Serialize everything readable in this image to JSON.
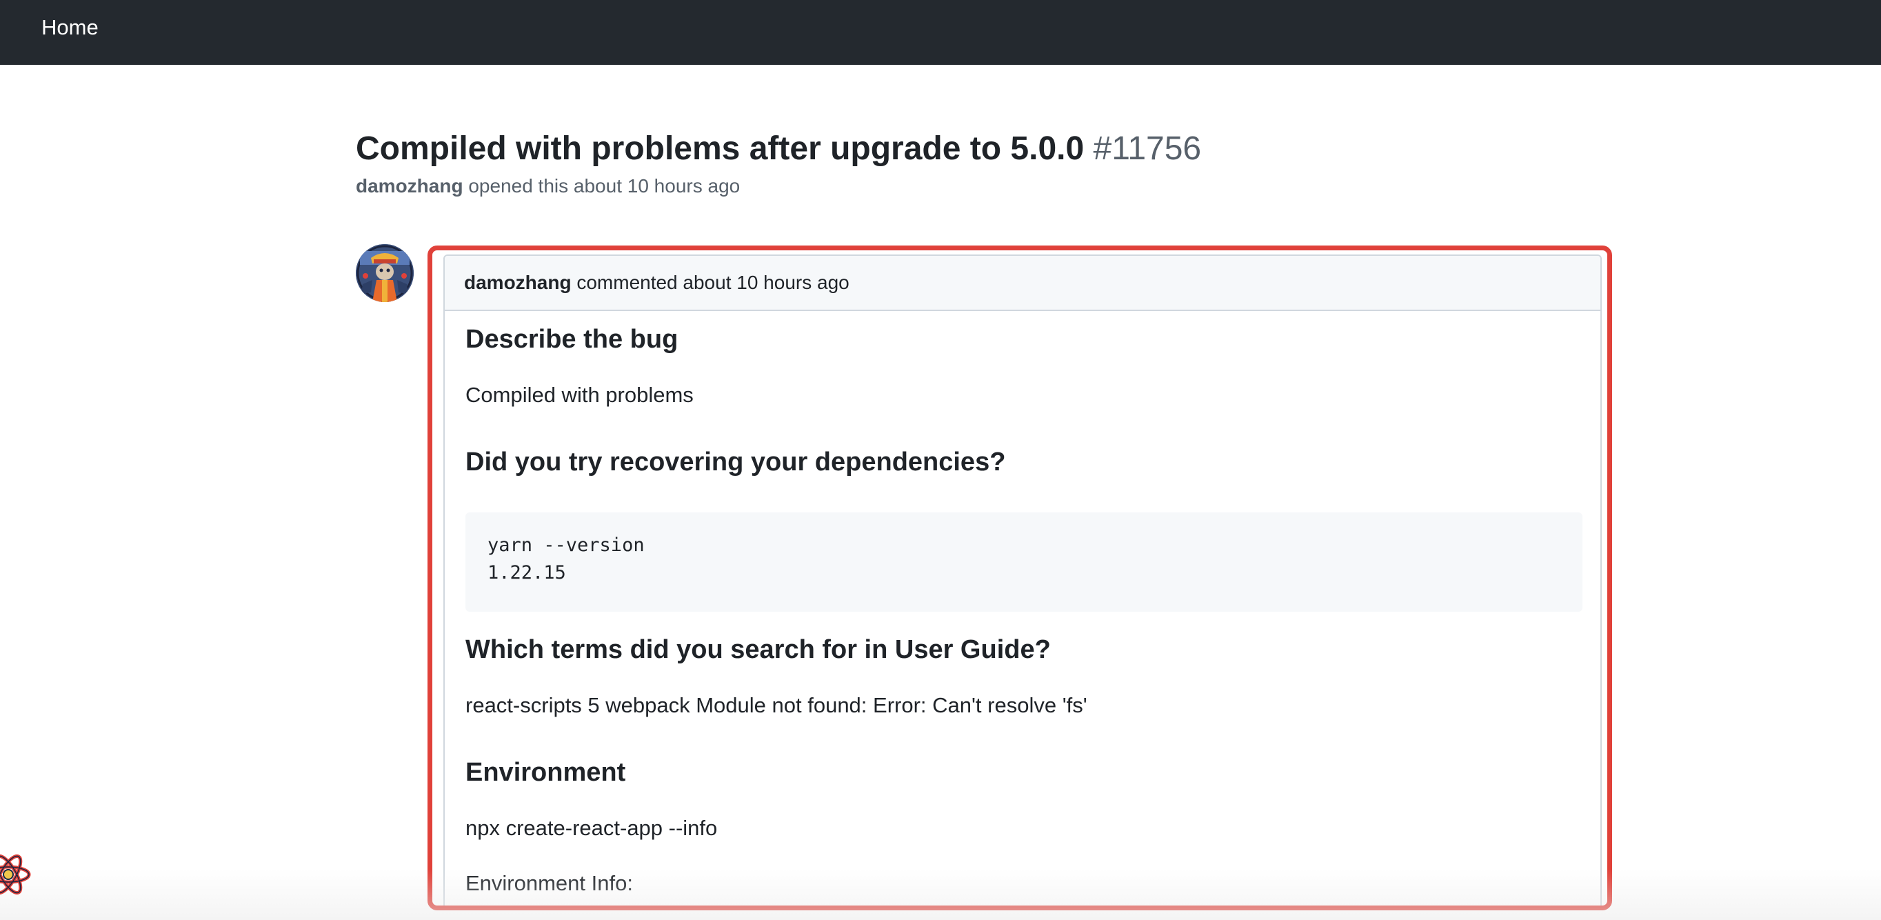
{
  "nav": {
    "home_label": "Home"
  },
  "issue": {
    "title": "Compiled with problems after upgrade to 5.0.0",
    "number": "#11756",
    "author": "damozhang",
    "opened_text": "opened this about 10 hours ago"
  },
  "comment": {
    "author": "damozhang",
    "commented_text": "commented about 10 hours ago",
    "sections": {
      "bug_heading": "Describe the bug",
      "bug_text": "Compiled with problems",
      "deps_heading": "Did you try recovering your dependencies?",
      "deps_code_line1": "yarn --version",
      "deps_code_line2": "1.22.15",
      "terms_heading": "Which terms did you search for in User Guide?",
      "terms_text": "react-scripts 5 webpack Module not found: Error: Can't resolve 'fs'",
      "env_heading": "Environment",
      "env_command": "npx create-react-app --info",
      "env_info": "Environment Info:"
    }
  },
  "colors": {
    "topbar": "#24292f",
    "highlight_border": "#e0413a",
    "code_background": "#f6f8fa"
  },
  "icons": {
    "avatar": "user-avatar",
    "bottom_left": "react-logo-icon"
  }
}
